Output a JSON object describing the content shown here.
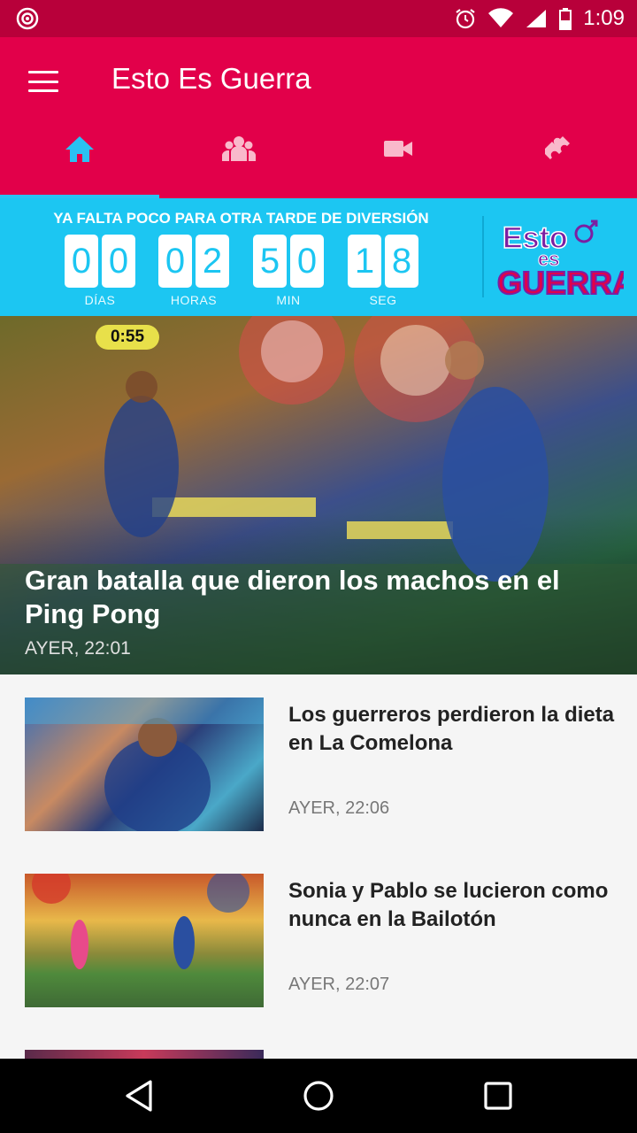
{
  "status_bar": {
    "time": "1:09",
    "icons": [
      "cast-icon",
      "alarm-icon",
      "wifi-icon",
      "signal-icon",
      "battery-icon"
    ]
  },
  "app_bar": {
    "title": "Esto Es Guerra",
    "menu_icon": "hamburger-menu-icon",
    "color": "#e2004a"
  },
  "tabs": [
    {
      "icon": "home-icon",
      "active": true
    },
    {
      "icon": "group-icon",
      "active": false
    },
    {
      "icon": "video-camera-icon",
      "active": false
    },
    {
      "icon": "puzzle-icon",
      "active": false
    }
  ],
  "countdown": {
    "title": "YA FALTA POCO PARA OTRA TARDE DE DIVERSIÓN",
    "units": [
      {
        "label": "DÍAS",
        "d1": "0",
        "d2": "0"
      },
      {
        "label": "HORAS",
        "d1": "0",
        "d2": "2"
      },
      {
        "label": "MIN",
        "d1": "5",
        "d2": "0"
      },
      {
        "label": "SEG",
        "d1": "1",
        "d2": "8"
      }
    ],
    "logo_text": "Esto es Guerra",
    "color": "#1cc6f2"
  },
  "featured": {
    "timer_overlay": "0:55",
    "title": "Gran batalla que dieron los machos  en el Ping Pong",
    "time": "AYER, 22:01"
  },
  "news": [
    {
      "title": "Los guerreros perdieron la dieta en La Comelona",
      "time": "AYER, 22:06"
    },
    {
      "title": "Sonia y Pablo se lucieron como nunca en la Bailotón",
      "time": "AYER, 22:07"
    }
  ]
}
